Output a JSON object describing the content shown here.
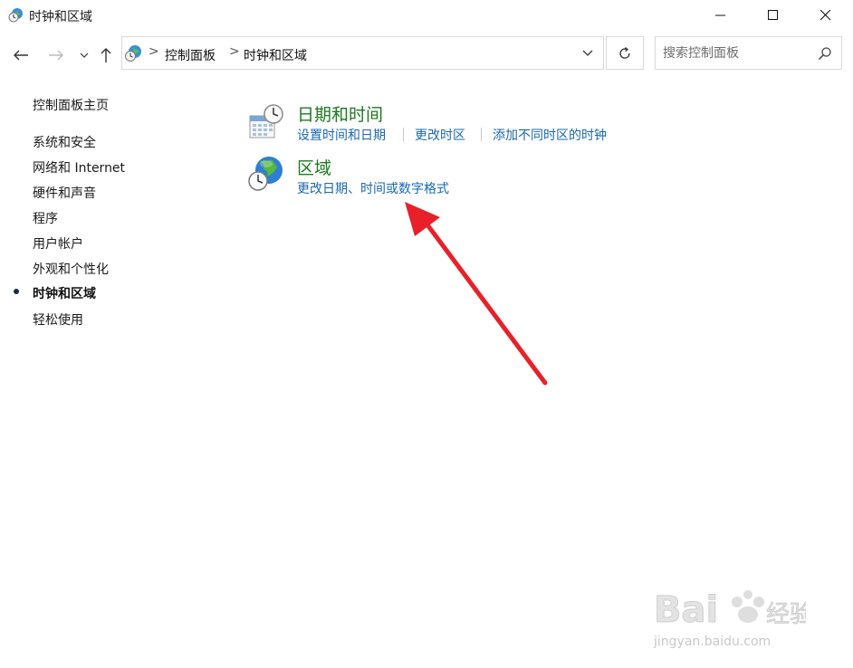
{
  "window": {
    "title": "时钟和区域",
    "app_icon": "clock-globe-icon",
    "controls": [
      "minimize-icon",
      "maximize-icon",
      "close-icon"
    ]
  },
  "navigation": {
    "back_icon": "arrow-left-icon",
    "forward_icon": "arrow-right-icon",
    "recent_icon": "chevron-down-icon",
    "up_icon": "arrow-up-icon",
    "refresh_icon": "refresh-icon"
  },
  "address": {
    "breadcrumb": [
      "控制面板",
      "时钟和区域"
    ],
    "separator": ">"
  },
  "search": {
    "placeholder": "搜索控制面板",
    "value": ""
  },
  "sidebar": {
    "home": "控制面板主页",
    "items": [
      {
        "label": "系统和安全",
        "active": false
      },
      {
        "label": "网络和 Internet",
        "active": false
      },
      {
        "label": "硬件和声音",
        "active": false
      },
      {
        "label": "程序",
        "active": false
      },
      {
        "label": "用户帐户",
        "active": false
      },
      {
        "label": "外观和个性化",
        "active": false
      },
      {
        "label": "时钟和区域",
        "active": true
      },
      {
        "label": "轻松使用",
        "active": false
      }
    ]
  },
  "categories": [
    {
      "title": "日期和时间",
      "icon": "calendar-clock-icon",
      "links": [
        "设置时间和日期",
        "更改时区",
        "添加不同时区的时钟"
      ]
    },
    {
      "title": "区域",
      "icon": "globe-clock-icon",
      "links": [
        "更改日期、时间或数字格式"
      ]
    }
  ],
  "annotation": {
    "arrow_color": "#e8202a"
  },
  "watermark": {
    "text": "Bai 经验",
    "url": "jingyan.baidu.com"
  },
  "colors": {
    "title_green": "#1d7a1f",
    "link_blue": "#1a68b0",
    "border": "#d9d9d9"
  }
}
